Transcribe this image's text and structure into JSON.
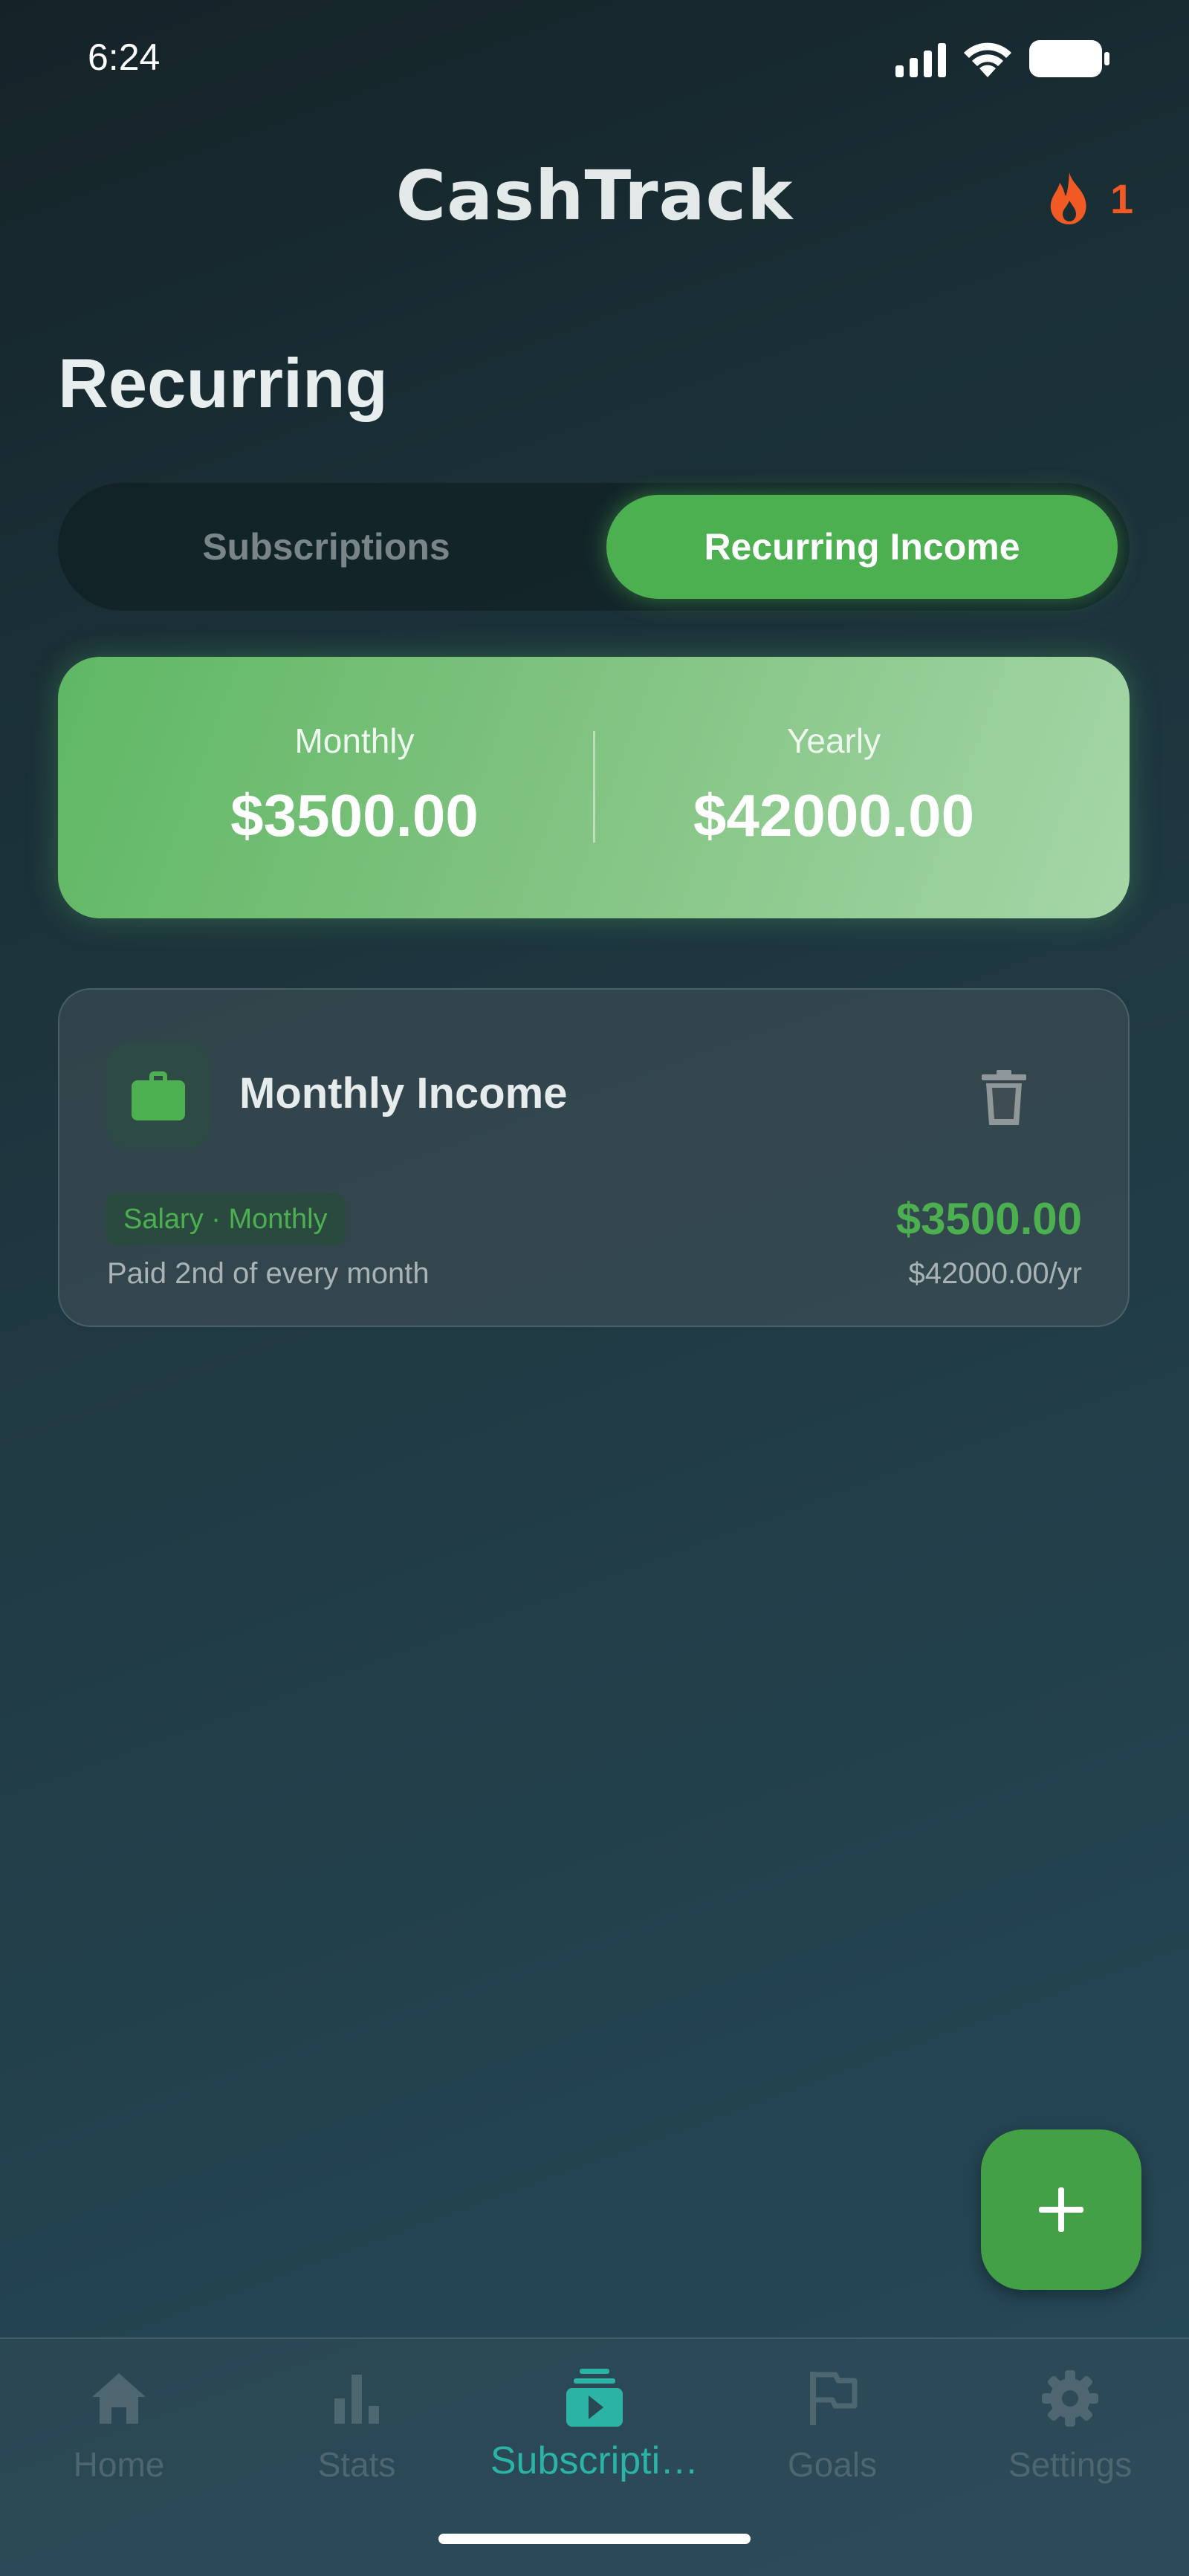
{
  "status_bar": {
    "time": "6:24"
  },
  "header": {
    "app_title": "CashTrack",
    "streak_count": "1"
  },
  "page": {
    "title": "Recurring"
  },
  "tabs": [
    {
      "label": "Subscriptions",
      "active": false
    },
    {
      "label": "Recurring Income",
      "active": true
    }
  ],
  "summary": {
    "monthly_label": "Monthly",
    "monthly_value": "$3500.00",
    "yearly_label": "Yearly",
    "yearly_value": "$42000.00"
  },
  "items": [
    {
      "name": "Monthly Income",
      "icon": "briefcase-icon",
      "tag": "Salary · Monthly",
      "note": "Paid 2nd of every month",
      "amount": "$3500.00",
      "yearly": "$42000.00/yr"
    }
  ],
  "bottom_nav": [
    {
      "label": "Home",
      "icon": "home-icon",
      "active": false
    },
    {
      "label": "Stats",
      "icon": "bar-chart-icon",
      "active": false
    },
    {
      "label": "Subscripti…",
      "icon": "subscriptions-icon",
      "active": true
    },
    {
      "label": "Goals",
      "icon": "flag-icon",
      "active": false
    },
    {
      "label": "Settings",
      "icon": "gear-icon",
      "active": false
    }
  ],
  "colors": {
    "accent": "#4caf50",
    "streak": "#f15a24",
    "nav_active": "#2bb3a6",
    "nav_inactive": "#4e6670"
  }
}
